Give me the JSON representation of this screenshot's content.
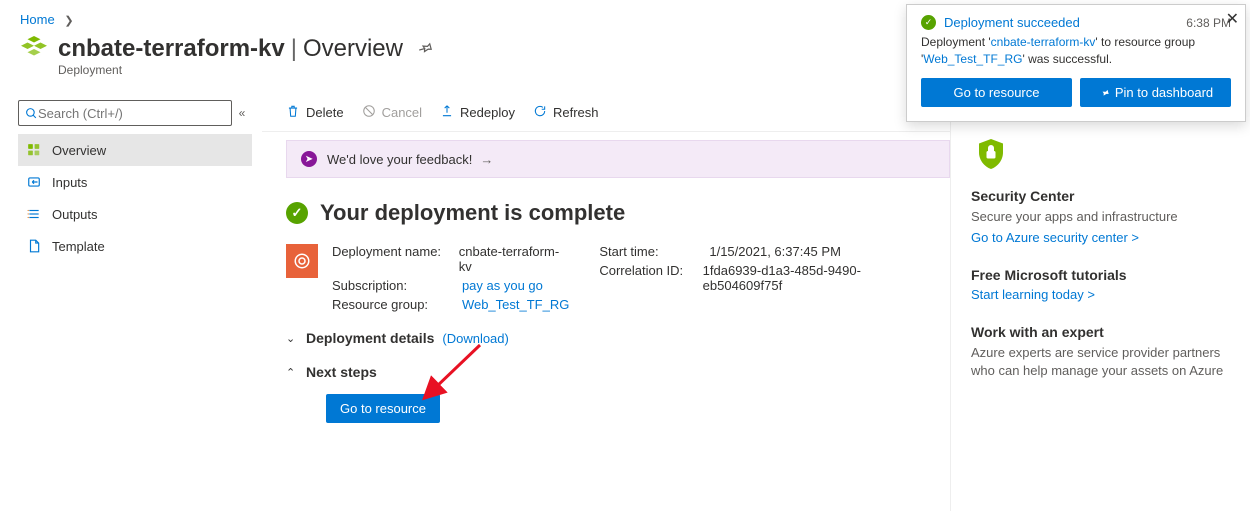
{
  "breadcrumb": {
    "home": "Home"
  },
  "header": {
    "resource_name": "cnbate-terraform-kv",
    "section": "Overview",
    "subtype": "Deployment"
  },
  "sidebar": {
    "search_placeholder": "Search (Ctrl+/)",
    "items": [
      {
        "label": "Overview"
      },
      {
        "label": "Inputs"
      },
      {
        "label": "Outputs"
      },
      {
        "label": "Template"
      }
    ]
  },
  "toolbar": {
    "delete": "Delete",
    "cancel": "Cancel",
    "redeploy": "Redeploy",
    "refresh": "Refresh"
  },
  "feedback": {
    "text": "We'd love your feedback!"
  },
  "complete": {
    "title": "Your deployment is complete"
  },
  "details": {
    "deployment_name_label": "Deployment name:",
    "deployment_name": "cnbate-terraform-kv",
    "subscription_label": "Subscription:",
    "subscription": "pay as you go",
    "resource_group_label": "Resource group:",
    "resource_group": "Web_Test_TF_RG",
    "start_time_label": "Start time:",
    "start_time": "1/15/2021, 6:37:45 PM",
    "correlation_label": "Correlation ID:",
    "correlation_id": "1fda6939-d1a3-485d-9490-eb504609f75f"
  },
  "expandables": {
    "details": "Deployment details",
    "download": "(Download)",
    "next_steps": "Next steps"
  },
  "buttons": {
    "go_to_resource": "Go to resource"
  },
  "right_pane": {
    "security_title": "Security Center",
    "security_desc": "Secure your apps and infrastructure",
    "security_link": "Go to Azure security center >",
    "tutorials_title": "Free Microsoft tutorials",
    "tutorials_link": "Start learning today >",
    "expert_title": "Work with an expert",
    "expert_desc": "Azure experts are service provider partners who can help manage your assets on Azure"
  },
  "toast": {
    "title": "Deployment succeeded",
    "time": "6:38 PM",
    "body_prefix": "Deployment '",
    "body_name": "cnbate-terraform-kv",
    "body_mid": "' to resource group '",
    "body_rg": "Web_Test_TF_RG",
    "body_suffix": "' was successful.",
    "go_to_resource": "Go to resource",
    "pin_dashboard": "Pin to dashboard"
  }
}
